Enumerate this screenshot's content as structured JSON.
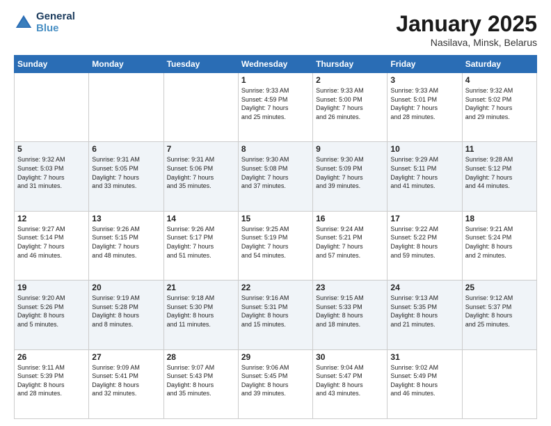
{
  "header": {
    "logo_line1": "General",
    "logo_line2": "Blue",
    "title": "January 2025",
    "subtitle": "Nasilava, Minsk, Belarus"
  },
  "weekdays": [
    "Sunday",
    "Monday",
    "Tuesday",
    "Wednesday",
    "Thursday",
    "Friday",
    "Saturday"
  ],
  "weeks": [
    [
      {
        "day": "",
        "content": ""
      },
      {
        "day": "",
        "content": ""
      },
      {
        "day": "",
        "content": ""
      },
      {
        "day": "1",
        "content": "Sunrise: 9:33 AM\nSunset: 4:59 PM\nDaylight: 7 hours\nand 25 minutes."
      },
      {
        "day": "2",
        "content": "Sunrise: 9:33 AM\nSunset: 5:00 PM\nDaylight: 7 hours\nand 26 minutes."
      },
      {
        "day": "3",
        "content": "Sunrise: 9:33 AM\nSunset: 5:01 PM\nDaylight: 7 hours\nand 28 minutes."
      },
      {
        "day": "4",
        "content": "Sunrise: 9:32 AM\nSunset: 5:02 PM\nDaylight: 7 hours\nand 29 minutes."
      }
    ],
    [
      {
        "day": "5",
        "content": "Sunrise: 9:32 AM\nSunset: 5:03 PM\nDaylight: 7 hours\nand 31 minutes."
      },
      {
        "day": "6",
        "content": "Sunrise: 9:31 AM\nSunset: 5:05 PM\nDaylight: 7 hours\nand 33 minutes."
      },
      {
        "day": "7",
        "content": "Sunrise: 9:31 AM\nSunset: 5:06 PM\nDaylight: 7 hours\nand 35 minutes."
      },
      {
        "day": "8",
        "content": "Sunrise: 9:30 AM\nSunset: 5:08 PM\nDaylight: 7 hours\nand 37 minutes."
      },
      {
        "day": "9",
        "content": "Sunrise: 9:30 AM\nSunset: 5:09 PM\nDaylight: 7 hours\nand 39 minutes."
      },
      {
        "day": "10",
        "content": "Sunrise: 9:29 AM\nSunset: 5:11 PM\nDaylight: 7 hours\nand 41 minutes."
      },
      {
        "day": "11",
        "content": "Sunrise: 9:28 AM\nSunset: 5:12 PM\nDaylight: 7 hours\nand 44 minutes."
      }
    ],
    [
      {
        "day": "12",
        "content": "Sunrise: 9:27 AM\nSunset: 5:14 PM\nDaylight: 7 hours\nand 46 minutes."
      },
      {
        "day": "13",
        "content": "Sunrise: 9:26 AM\nSunset: 5:15 PM\nDaylight: 7 hours\nand 48 minutes."
      },
      {
        "day": "14",
        "content": "Sunrise: 9:26 AM\nSunset: 5:17 PM\nDaylight: 7 hours\nand 51 minutes."
      },
      {
        "day": "15",
        "content": "Sunrise: 9:25 AM\nSunset: 5:19 PM\nDaylight: 7 hours\nand 54 minutes."
      },
      {
        "day": "16",
        "content": "Sunrise: 9:24 AM\nSunset: 5:21 PM\nDaylight: 7 hours\nand 57 minutes."
      },
      {
        "day": "17",
        "content": "Sunrise: 9:22 AM\nSunset: 5:22 PM\nDaylight: 8 hours\nand 59 minutes."
      },
      {
        "day": "18",
        "content": "Sunrise: 9:21 AM\nSunset: 5:24 PM\nDaylight: 8 hours\nand 2 minutes."
      }
    ],
    [
      {
        "day": "19",
        "content": "Sunrise: 9:20 AM\nSunset: 5:26 PM\nDaylight: 8 hours\nand 5 minutes."
      },
      {
        "day": "20",
        "content": "Sunrise: 9:19 AM\nSunset: 5:28 PM\nDaylight: 8 hours\nand 8 minutes."
      },
      {
        "day": "21",
        "content": "Sunrise: 9:18 AM\nSunset: 5:30 PM\nDaylight: 8 hours\nand 11 minutes."
      },
      {
        "day": "22",
        "content": "Sunrise: 9:16 AM\nSunset: 5:31 PM\nDaylight: 8 hours\nand 15 minutes."
      },
      {
        "day": "23",
        "content": "Sunrise: 9:15 AM\nSunset: 5:33 PM\nDaylight: 8 hours\nand 18 minutes."
      },
      {
        "day": "24",
        "content": "Sunrise: 9:13 AM\nSunset: 5:35 PM\nDaylight: 8 hours\nand 21 minutes."
      },
      {
        "day": "25",
        "content": "Sunrise: 9:12 AM\nSunset: 5:37 PM\nDaylight: 8 hours\nand 25 minutes."
      }
    ],
    [
      {
        "day": "26",
        "content": "Sunrise: 9:11 AM\nSunset: 5:39 PM\nDaylight: 8 hours\nand 28 minutes."
      },
      {
        "day": "27",
        "content": "Sunrise: 9:09 AM\nSunset: 5:41 PM\nDaylight: 8 hours\nand 32 minutes."
      },
      {
        "day": "28",
        "content": "Sunrise: 9:07 AM\nSunset: 5:43 PM\nDaylight: 8 hours\nand 35 minutes."
      },
      {
        "day": "29",
        "content": "Sunrise: 9:06 AM\nSunset: 5:45 PM\nDaylight: 8 hours\nand 39 minutes."
      },
      {
        "day": "30",
        "content": "Sunrise: 9:04 AM\nSunset: 5:47 PM\nDaylight: 8 hours\nand 43 minutes."
      },
      {
        "day": "31",
        "content": "Sunrise: 9:02 AM\nSunset: 5:49 PM\nDaylight: 8 hours\nand 46 minutes."
      },
      {
        "day": "",
        "content": ""
      }
    ]
  ]
}
